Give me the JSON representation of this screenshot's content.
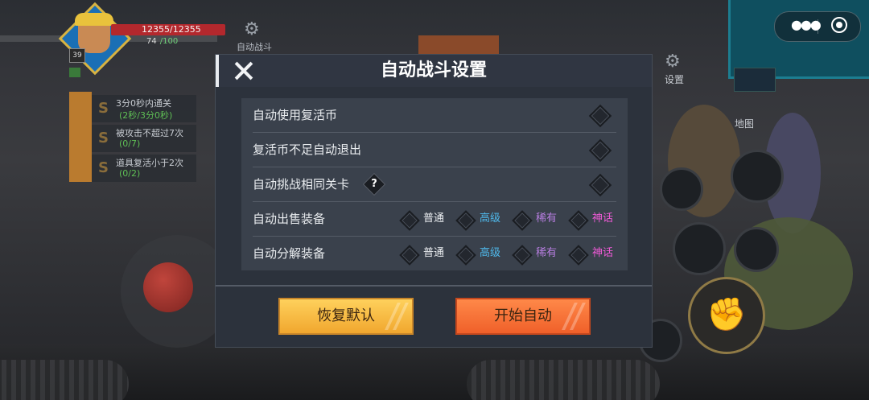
{
  "hud": {
    "hp_text": "12355/12355",
    "mp_value": "74",
    "mp_extra": "/100",
    "level": "39",
    "auto_battle_label": "自动战斗",
    "settings_label": "设置",
    "map_label": "地图"
  },
  "missions": [
    {
      "star": "S",
      "title": "3分0秒内通关",
      "progress": "(2秒/3分0秒)"
    },
    {
      "star": "S",
      "title": "被攻击不超过7次",
      "progress": "(0/7)"
    },
    {
      "star": "S",
      "title": "道具复活小于2次",
      "progress": "(0/2)"
    }
  ],
  "modal": {
    "title": "自动战斗设置",
    "toggles": [
      {
        "label": "自动使用复活币"
      },
      {
        "label": "复活币不足自动退出"
      },
      {
        "label": "自动挑战相同关卡"
      }
    ],
    "help_glyph": "?",
    "sell_label": "自动出售装备",
    "dismantle_label": "自动分解装备",
    "rarity_options": [
      {
        "label": "普通",
        "color": "#e9ecef"
      },
      {
        "label": "高级",
        "color": "#4fb8ea"
      },
      {
        "label": "稀有",
        "color": "#b77ee0"
      },
      {
        "label": "神话",
        "color": "#ee5ad6"
      }
    ],
    "reset_button": "恢复默认",
    "start_button": "开始自动"
  },
  "colors": {
    "reset_button": "#f7bd45",
    "start_button": "#f47338",
    "modal_bg": "#2c323c",
    "panel_bg": "#3a414c"
  }
}
